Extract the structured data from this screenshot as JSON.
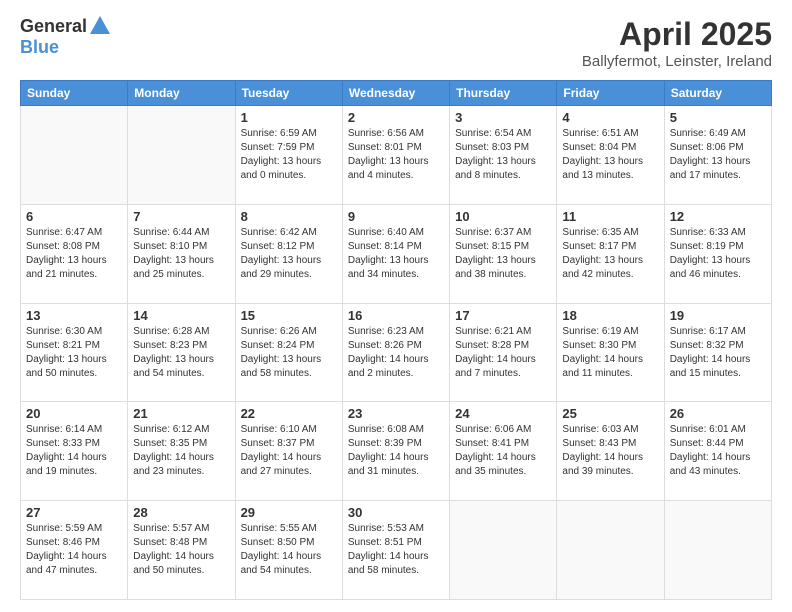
{
  "header": {
    "logo_general": "General",
    "logo_blue": "Blue",
    "title": "April 2025",
    "location": "Ballyfermot, Leinster, Ireland"
  },
  "weekdays": [
    "Sunday",
    "Monday",
    "Tuesday",
    "Wednesday",
    "Thursday",
    "Friday",
    "Saturday"
  ],
  "weeks": [
    [
      {
        "day": "",
        "info": ""
      },
      {
        "day": "",
        "info": ""
      },
      {
        "day": "1",
        "info": "Sunrise: 6:59 AM\nSunset: 7:59 PM\nDaylight: 13 hours\nand 0 minutes."
      },
      {
        "day": "2",
        "info": "Sunrise: 6:56 AM\nSunset: 8:01 PM\nDaylight: 13 hours\nand 4 minutes."
      },
      {
        "day": "3",
        "info": "Sunrise: 6:54 AM\nSunset: 8:03 PM\nDaylight: 13 hours\nand 8 minutes."
      },
      {
        "day": "4",
        "info": "Sunrise: 6:51 AM\nSunset: 8:04 PM\nDaylight: 13 hours\nand 13 minutes."
      },
      {
        "day": "5",
        "info": "Sunrise: 6:49 AM\nSunset: 8:06 PM\nDaylight: 13 hours\nand 17 minutes."
      }
    ],
    [
      {
        "day": "6",
        "info": "Sunrise: 6:47 AM\nSunset: 8:08 PM\nDaylight: 13 hours\nand 21 minutes."
      },
      {
        "day": "7",
        "info": "Sunrise: 6:44 AM\nSunset: 8:10 PM\nDaylight: 13 hours\nand 25 minutes."
      },
      {
        "day": "8",
        "info": "Sunrise: 6:42 AM\nSunset: 8:12 PM\nDaylight: 13 hours\nand 29 minutes."
      },
      {
        "day": "9",
        "info": "Sunrise: 6:40 AM\nSunset: 8:14 PM\nDaylight: 13 hours\nand 34 minutes."
      },
      {
        "day": "10",
        "info": "Sunrise: 6:37 AM\nSunset: 8:15 PM\nDaylight: 13 hours\nand 38 minutes."
      },
      {
        "day": "11",
        "info": "Sunrise: 6:35 AM\nSunset: 8:17 PM\nDaylight: 13 hours\nand 42 minutes."
      },
      {
        "day": "12",
        "info": "Sunrise: 6:33 AM\nSunset: 8:19 PM\nDaylight: 13 hours\nand 46 minutes."
      }
    ],
    [
      {
        "day": "13",
        "info": "Sunrise: 6:30 AM\nSunset: 8:21 PM\nDaylight: 13 hours\nand 50 minutes."
      },
      {
        "day": "14",
        "info": "Sunrise: 6:28 AM\nSunset: 8:23 PM\nDaylight: 13 hours\nand 54 minutes."
      },
      {
        "day": "15",
        "info": "Sunrise: 6:26 AM\nSunset: 8:24 PM\nDaylight: 13 hours\nand 58 minutes."
      },
      {
        "day": "16",
        "info": "Sunrise: 6:23 AM\nSunset: 8:26 PM\nDaylight: 14 hours\nand 2 minutes."
      },
      {
        "day": "17",
        "info": "Sunrise: 6:21 AM\nSunset: 8:28 PM\nDaylight: 14 hours\nand 7 minutes."
      },
      {
        "day": "18",
        "info": "Sunrise: 6:19 AM\nSunset: 8:30 PM\nDaylight: 14 hours\nand 11 minutes."
      },
      {
        "day": "19",
        "info": "Sunrise: 6:17 AM\nSunset: 8:32 PM\nDaylight: 14 hours\nand 15 minutes."
      }
    ],
    [
      {
        "day": "20",
        "info": "Sunrise: 6:14 AM\nSunset: 8:33 PM\nDaylight: 14 hours\nand 19 minutes."
      },
      {
        "day": "21",
        "info": "Sunrise: 6:12 AM\nSunset: 8:35 PM\nDaylight: 14 hours\nand 23 minutes."
      },
      {
        "day": "22",
        "info": "Sunrise: 6:10 AM\nSunset: 8:37 PM\nDaylight: 14 hours\nand 27 minutes."
      },
      {
        "day": "23",
        "info": "Sunrise: 6:08 AM\nSunset: 8:39 PM\nDaylight: 14 hours\nand 31 minutes."
      },
      {
        "day": "24",
        "info": "Sunrise: 6:06 AM\nSunset: 8:41 PM\nDaylight: 14 hours\nand 35 minutes."
      },
      {
        "day": "25",
        "info": "Sunrise: 6:03 AM\nSunset: 8:43 PM\nDaylight: 14 hours\nand 39 minutes."
      },
      {
        "day": "26",
        "info": "Sunrise: 6:01 AM\nSunset: 8:44 PM\nDaylight: 14 hours\nand 43 minutes."
      }
    ],
    [
      {
        "day": "27",
        "info": "Sunrise: 5:59 AM\nSunset: 8:46 PM\nDaylight: 14 hours\nand 47 minutes."
      },
      {
        "day": "28",
        "info": "Sunrise: 5:57 AM\nSunset: 8:48 PM\nDaylight: 14 hours\nand 50 minutes."
      },
      {
        "day": "29",
        "info": "Sunrise: 5:55 AM\nSunset: 8:50 PM\nDaylight: 14 hours\nand 54 minutes."
      },
      {
        "day": "30",
        "info": "Sunrise: 5:53 AM\nSunset: 8:51 PM\nDaylight: 14 hours\nand 58 minutes."
      },
      {
        "day": "",
        "info": ""
      },
      {
        "day": "",
        "info": ""
      },
      {
        "day": "",
        "info": ""
      }
    ]
  ]
}
